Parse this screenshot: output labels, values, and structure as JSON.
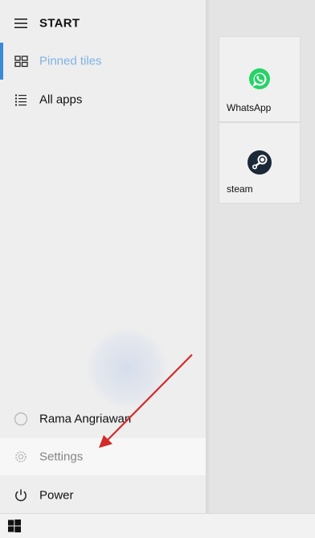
{
  "start_menu": {
    "title": "START",
    "items": {
      "pinned_tiles": "Pinned tiles",
      "all_apps": "All apps",
      "user": "Rama Angriawan",
      "settings": "Settings",
      "power": "Power"
    }
  },
  "tiles": [
    {
      "label": "WhatsApp",
      "icon": "whatsapp-icon",
      "color": "#25d366"
    },
    {
      "label": "steam",
      "icon": "steam-icon",
      "color": "#1b2838"
    }
  ],
  "colors": {
    "accent": "#3a8ad6",
    "annotation_arrow": "#d42a2a"
  }
}
